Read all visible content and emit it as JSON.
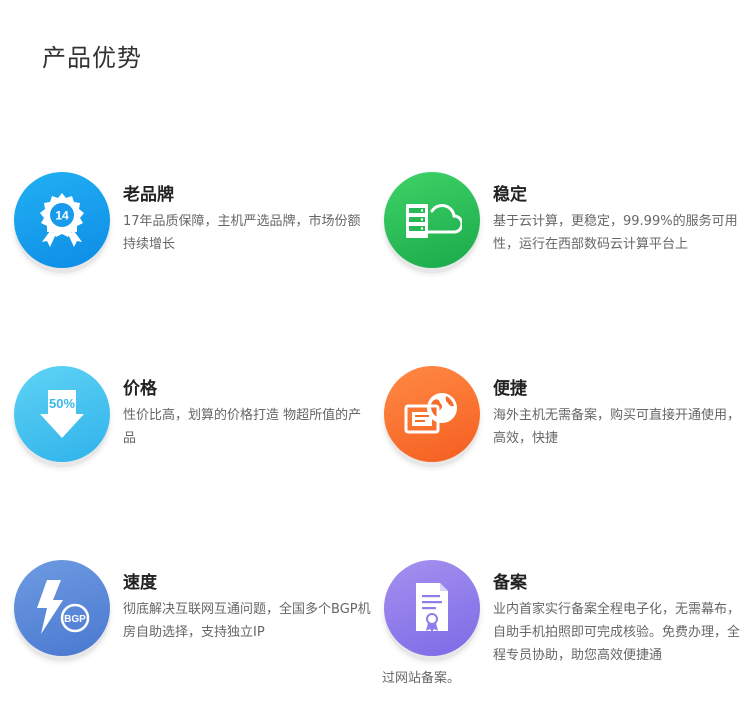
{
  "section": {
    "title": "产品优势"
  },
  "features": [
    {
      "title": "老品牌",
      "desc": "17年品质保障，主机严选品牌，市场份额持续增长",
      "icon": "award-medal-icon",
      "icon_text": "14",
      "color": "#0d8ce6"
    },
    {
      "title": "稳定",
      "desc": "基于云计算，更稳定，99.99%的服务可用性，运行在西部数码云计算平台上",
      "icon": "server-cloud-icon",
      "color": "#1aa94a"
    },
    {
      "title": "价格",
      "desc": "性价比高，划算的价格打造 物超所值的产品",
      "icon": "price-down-icon",
      "icon_text": "50%",
      "color": "#2fb2ea"
    },
    {
      "title": "便捷",
      "desc": "海外主机无需备案，购买可直接开通使用，高效，快捷",
      "icon": "globe-window-icon",
      "color": "#f55e1f"
    },
    {
      "title": "速度",
      "desc": "彻底解决互联网互通问题，全国多个BGP机房自助选择，支持独立IP",
      "icon": "lightning-bgp-icon",
      "icon_text": "BGP",
      "color": "#4a78cf"
    },
    {
      "title": "备案",
      "desc": "业内首家实行备案全程电子化，无需幕布，自助手机拍照即可完成核验。免费办理，全程专员协助，助您高效便捷通",
      "desc_tail": "过网站备案。",
      "icon": "certificate-document-icon",
      "color": "#7d6ae6"
    }
  ]
}
